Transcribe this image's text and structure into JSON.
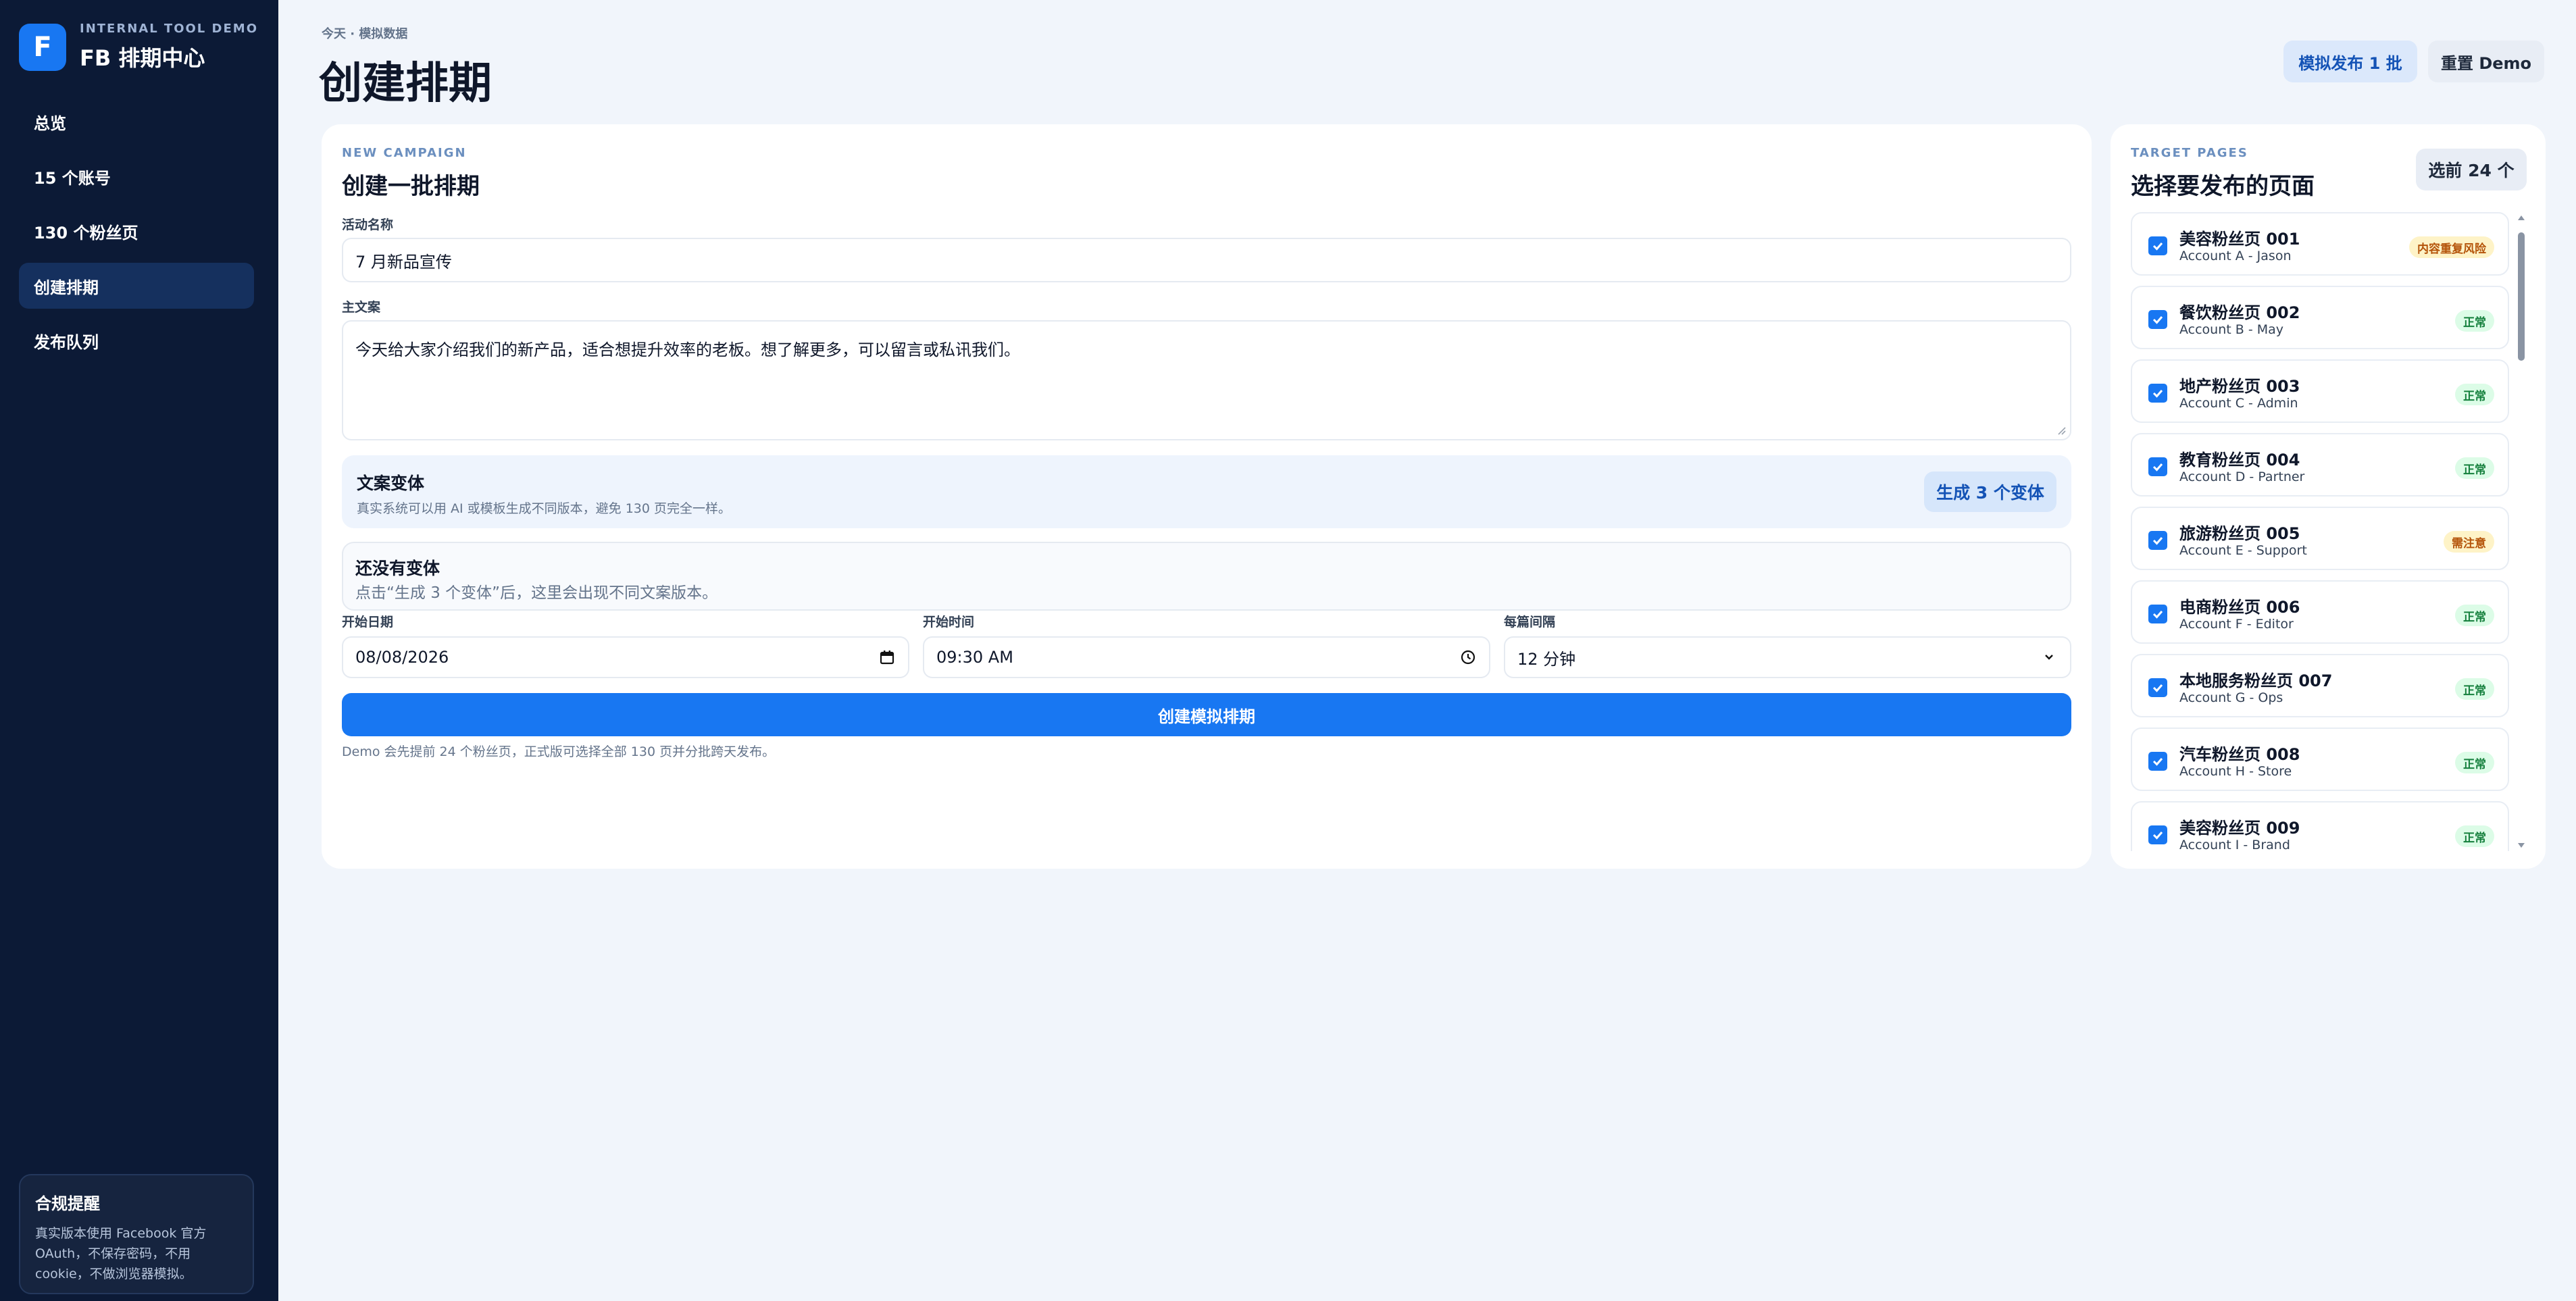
{
  "sidebar": {
    "brand_logo": "F",
    "brand_sub": "INTERNAL TOOL DEMO",
    "brand_title": "FB 排期中心",
    "nav": [
      "总览",
      "15 个账号",
      "130 个粉丝页",
      "创建排期",
      "发布队列"
    ],
    "active_nav": "创建排期",
    "notice_title": "合规提醒",
    "notice_body": "真实版本使用 Facebook 官方 OAuth，不保存密码，不用 cookie，不做浏览器模拟。"
  },
  "header": {
    "crumb": "今天 · 模拟数据",
    "title": "创建排期",
    "publish_button": "模拟发布 1 批",
    "reset_button": "重置 Demo"
  },
  "campaign": {
    "eyebrow": "NEW CAMPAIGN",
    "title": "创建一批排期",
    "name_label": "活动名称",
    "name_value": "7 月新品宣传",
    "copy_label": "主文案",
    "copy_value": "今天给大家介绍我们的新产品，适合想提升效率的老板。想了解更多，可以留言或私讯我们。",
    "variant_title": "文案变体",
    "variant_hint": "真实系统可以用 AI 或模板生成不同版本，避免 130 页完全一样。",
    "variant_button": "生成 3 个变体",
    "empty_title": "还没有变体",
    "empty_hint": "点击“生成 3 个变体”后，这里会出现不同文案版本。",
    "date_label": "开始日期",
    "date_value": "08/08/2026",
    "time_label": "开始时间",
    "time_value": "09:30 AM",
    "interval_label": "每篇间隔",
    "interval_value": "12 分钟",
    "create_button": "创建模拟排期",
    "footnote": "Demo 会先提前 24 个粉丝页，正式版可选择全部 130 页并分批跨天发布。"
  },
  "targets": {
    "eyebrow": "TARGET PAGES",
    "title": "选择要发布的页面",
    "selected": "选前 24 个",
    "pages": [
      {
        "name": "美容粉丝页 001",
        "account": "Account A - Jason",
        "status": "内容重复风险",
        "level": "warn"
      },
      {
        "name": "餐饮粉丝页 002",
        "account": "Account B - May",
        "status": "正常",
        "level": "ok"
      },
      {
        "name": "地产粉丝页 003",
        "account": "Account C - Admin",
        "status": "正常",
        "level": "ok"
      },
      {
        "name": "教育粉丝页 004",
        "account": "Account D - Partner",
        "status": "正常",
        "level": "ok"
      },
      {
        "name": "旅游粉丝页 005",
        "account": "Account E - Support",
        "status": "需注意",
        "level": "warn"
      },
      {
        "name": "电商粉丝页 006",
        "account": "Account F - Editor",
        "status": "正常",
        "level": "ok"
      },
      {
        "name": "本地服务粉丝页 007",
        "account": "Account G - Ops",
        "status": "正常",
        "level": "ok"
      },
      {
        "name": "汽车粉丝页 008",
        "account": "Account H - Store",
        "status": "正常",
        "level": "ok"
      },
      {
        "name": "美容粉丝页 009",
        "account": "Account I - Brand",
        "status": "正常",
        "level": "ok"
      }
    ]
  },
  "colors": {
    "accent": "#1877f2",
    "sidebar": "#0c1a36",
    "ok": "#15803d",
    "warn": "#b45309"
  }
}
